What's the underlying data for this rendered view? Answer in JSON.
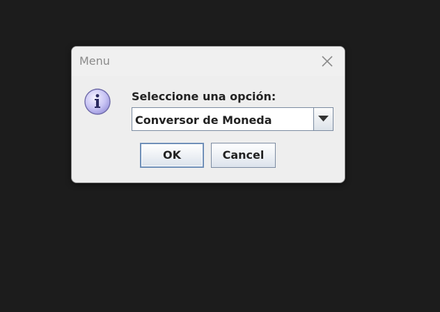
{
  "dialog": {
    "title": "Menu",
    "prompt": "Seleccione una opción:",
    "selected_option": "Conversor de Moneda",
    "ok_label": "OK",
    "cancel_label": "Cancel",
    "icon": "info-icon",
    "close_icon": "close-icon"
  },
  "colors": {
    "desktop_background": "#1c1c1c",
    "dialog_background": "#eeeeee",
    "info_icon_fill": "#c8c4f4"
  }
}
